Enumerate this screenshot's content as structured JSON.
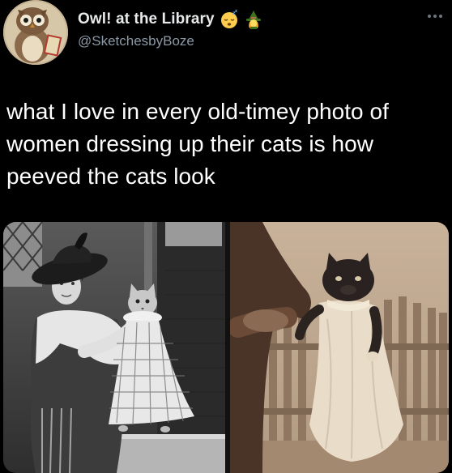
{
  "author": {
    "display_name": "Owl! at the Library",
    "handle": "@SketchesbyBoze",
    "badges": [
      "sleeping-face-emoji",
      "witch-emoji"
    ]
  },
  "tweet": {
    "text": "what I love in every old-timey photo of\nwomen dressing up their cats is how\npeeved the cats look"
  },
  "media": {
    "photos": [
      {
        "name": "woman-with-dressed-cat-photo",
        "style": "black-and-white"
      },
      {
        "name": "cat-in-apron-photo",
        "style": "sepia"
      }
    ]
  },
  "colors": {
    "background": "#000000",
    "text": "#ffffff",
    "secondary_text": "#8b98a5"
  }
}
